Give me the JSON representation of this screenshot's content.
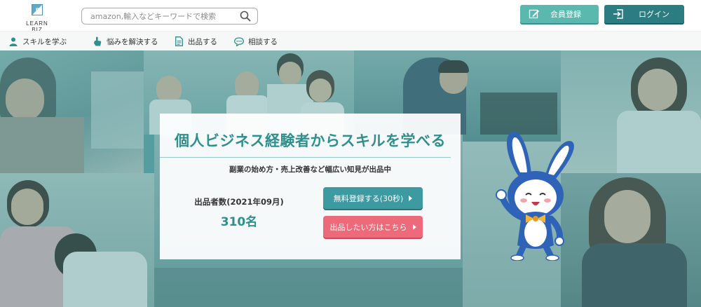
{
  "header": {
    "logo_text": "LEARN BIZ",
    "logo_letter": "B",
    "search_placeholder": "amazon,輸入などキーワードで検索",
    "register_label": "会員登録",
    "login_label": "ログイン"
  },
  "nav": {
    "items": [
      {
        "label": "スキルを学ぶ",
        "icon": "person-icon"
      },
      {
        "label": "悩みを解決する",
        "icon": "hand-pointer-icon"
      },
      {
        "label": "出品する",
        "icon": "document-icon"
      },
      {
        "label": "相談する",
        "icon": "chat-bubble-icon"
      }
    ]
  },
  "hero": {
    "title": "個人ビジネス経験者からスキルを学べる",
    "subtitle": "副業の始め方・売上改善など幅広い知見が出品中",
    "count_label": "出品者数(2021年09月)",
    "count_value": "310名",
    "cta_register": "無料登録する(30秒)",
    "cta_sell": "出品したい方はこちら"
  },
  "colors": {
    "teal": "#2f8f8c",
    "register_button": "#5bb8ae",
    "login_button": "#2c7d82",
    "cta_register": "#3d9aa0",
    "cta_sell": "#ec6a7a"
  }
}
